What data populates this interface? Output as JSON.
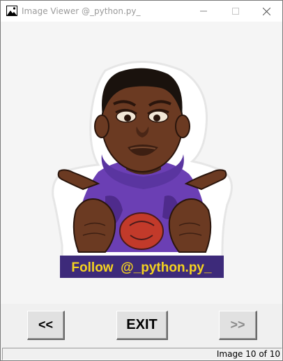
{
  "window": {
    "title": "Image Viewer @_python.py_"
  },
  "image": {
    "caption": "Follow  @_python.py_",
    "caption_color": "#f5d31f",
    "caption_bg": "#3d2a7a",
    "hoodie_color": "#6b3fb4",
    "skin_color": "#6b3a22"
  },
  "controls": {
    "prev_label": "<<",
    "exit_label": "EXIT",
    "next_label": ">>"
  },
  "status": {
    "text": "Image 10 of 10",
    "current": 10,
    "total": 10
  }
}
